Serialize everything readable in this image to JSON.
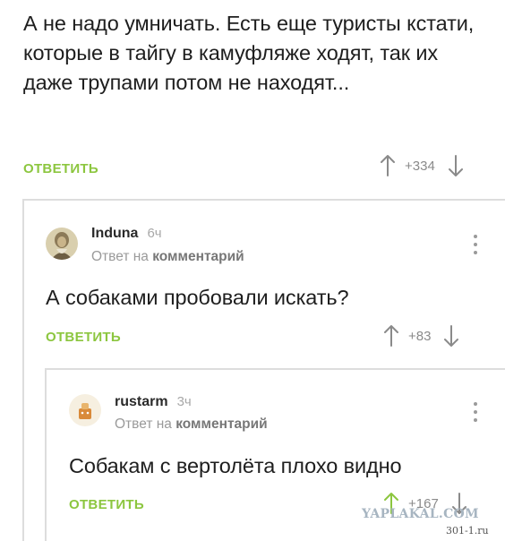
{
  "comment_root": {
    "text": "А не надо умничать. Есть еще туристы кстати, которые в тайгу в камуфляже ходят, так их даже трупами потом не находят...",
    "reply_label": "ОТВЕТИТЬ",
    "score": "+334"
  },
  "comment_reply_1": {
    "author": "Induna",
    "time": "6ч",
    "reply_to_prefix": "Ответ на",
    "reply_to_link": "комментарий",
    "text": "А собаками пробовали искать?",
    "reply_label": "ОТВЕТИТЬ",
    "score": "+83"
  },
  "comment_reply_2": {
    "author": "rustarm",
    "time": "3ч",
    "reply_to_prefix": "Ответ на",
    "reply_to_link": "комментарий",
    "text": "Собакам с вертолёта плохо видно",
    "reply_label": "ОТВЕТИТЬ",
    "score": "+167"
  },
  "watermark": {
    "brand": "YAPLAKAL.COM",
    "site": "301-1.ru"
  },
  "colors": {
    "reply_green": "#8cc63f",
    "thread_line": "#dddddd",
    "muted": "#9a9a9a"
  },
  "icons": [
    "upvote-arrow-icon",
    "downvote-arrow-icon",
    "more-menu-icon",
    "avatar-image"
  ]
}
